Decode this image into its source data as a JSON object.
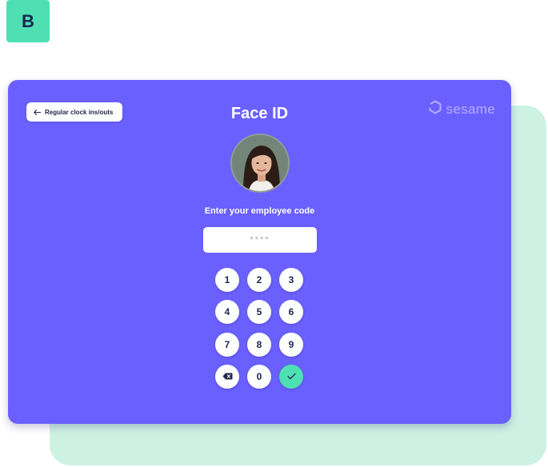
{
  "badge": {
    "letter": "B"
  },
  "panel": {
    "back_label": "Regular clock ins/outs",
    "title": "Face ID",
    "brand": "sesame",
    "prompt": "Enter your employee code",
    "code_placeholder": "****"
  },
  "keypad": {
    "keys": [
      "1",
      "2",
      "3",
      "4",
      "5",
      "6",
      "7",
      "8",
      "9",
      "0"
    ],
    "backspace_icon": "backspace-icon",
    "confirm_icon": "check-icon"
  },
  "colors": {
    "panel": "#6a60ff",
    "accent_mint": "#4ee0b3",
    "back_card": "#cdf2e4",
    "text_dark": "#22264a"
  }
}
